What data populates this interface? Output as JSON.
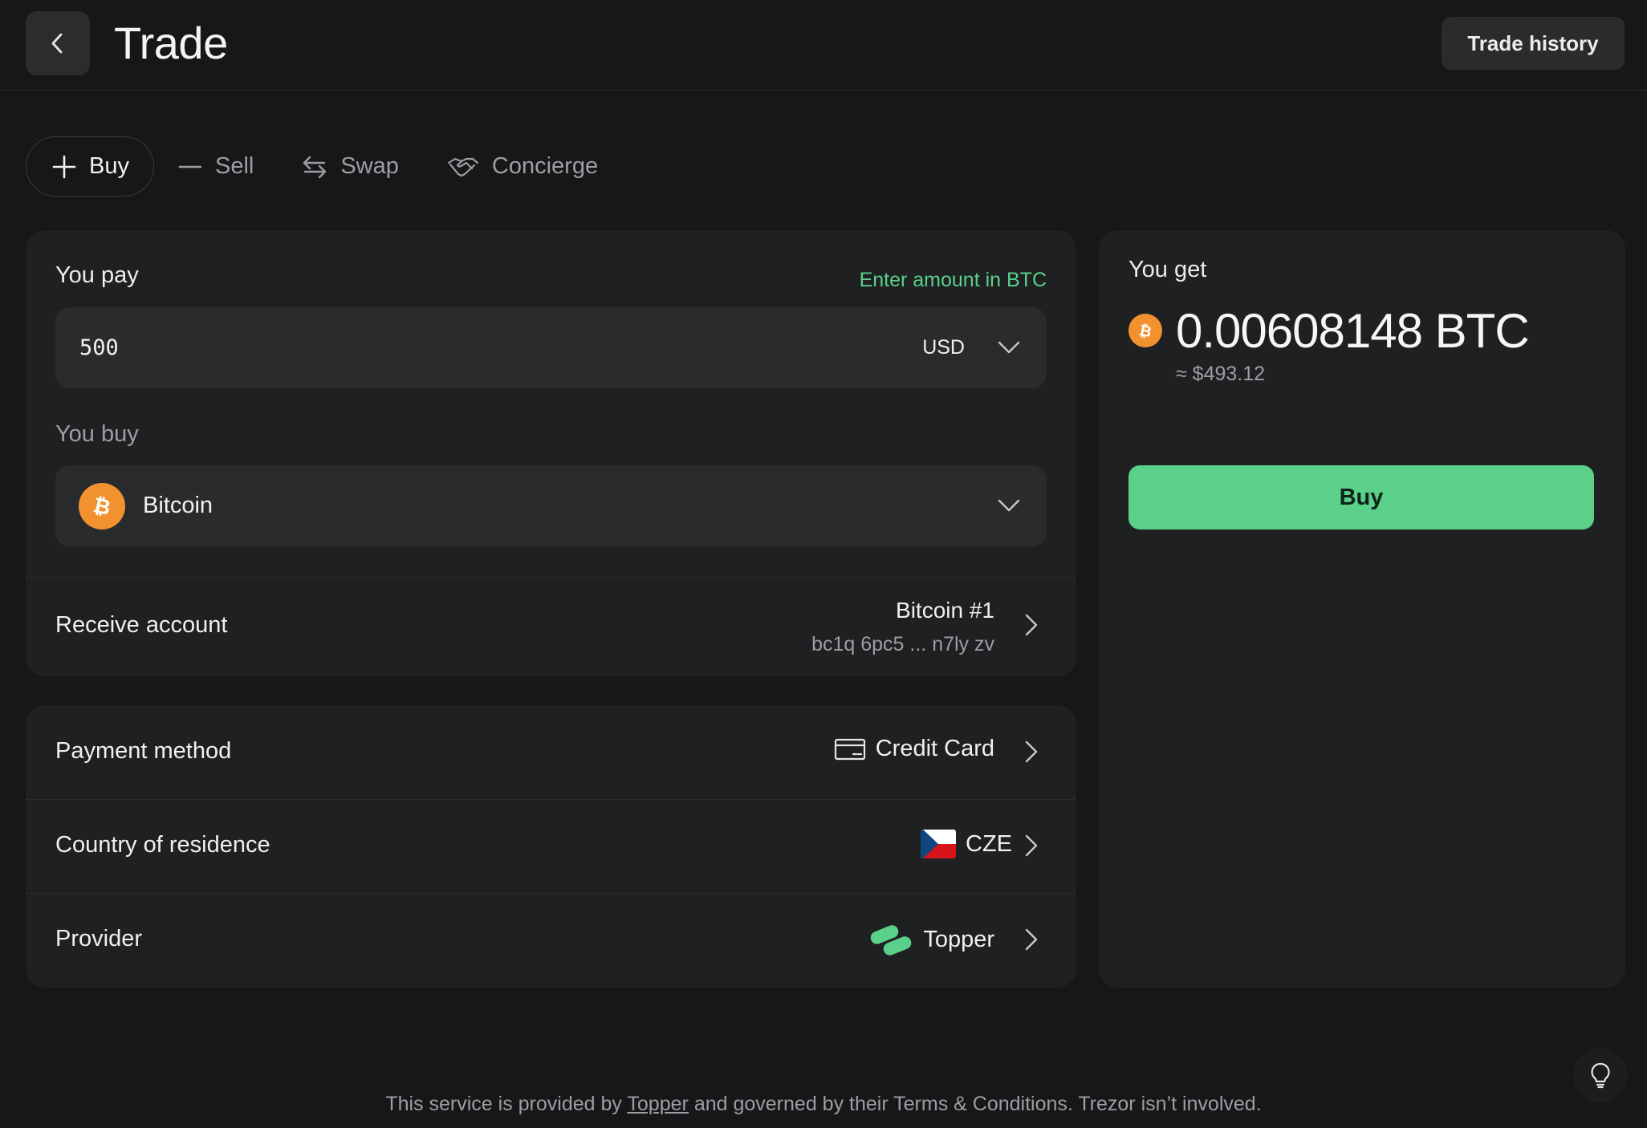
{
  "header": {
    "title": "Trade",
    "trade_history_label": "Trade history"
  },
  "tabs": [
    {
      "label": "Buy",
      "icon": "plus-icon",
      "active": true
    },
    {
      "label": "Sell",
      "icon": "minus-icon",
      "active": false
    },
    {
      "label": "Swap",
      "icon": "swap-arrows-icon",
      "active": false
    },
    {
      "label": "Concierge",
      "icon": "handshake-icon",
      "active": false
    }
  ],
  "pay": {
    "label": "You pay",
    "toggle_label": "Enter amount in BTC",
    "amount": "500",
    "currency": "USD"
  },
  "buy": {
    "label": "You buy",
    "coin": "Bitcoin",
    "coin_icon": "bitcoin-icon"
  },
  "receive": {
    "label": "Receive account",
    "account_name": "Bitcoin #1",
    "address": "bc1q 6pc5 ... n7ly zv"
  },
  "payment_method": {
    "label": "Payment method",
    "value": "Credit Card",
    "icon": "credit-card-icon"
  },
  "country": {
    "label": "Country of residence",
    "value": "CZE",
    "icon": "czech-flag-icon"
  },
  "provider": {
    "label": "Provider",
    "value": "Topper",
    "icon": "topper-logo-icon"
  },
  "get": {
    "label": "You get",
    "amount": "0.00608148 BTC",
    "fiat": "≈ $493.12",
    "buy_button_label": "Buy"
  },
  "footer": {
    "prefix": "This service is provided by",
    "provider_link": "Topper",
    "suffix": "and governed by their Terms & Conditions. Trezor isn’t involved."
  },
  "colors": {
    "accent_green": "#5ad08a",
    "bitcoin_orange": "#f2922f",
    "background": "#161718",
    "card": "#1f2022"
  }
}
